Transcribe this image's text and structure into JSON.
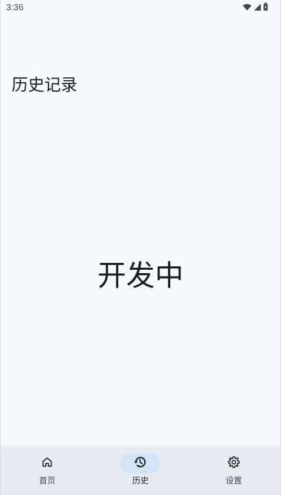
{
  "status_bar": {
    "time": "3:36",
    "icons": [
      "wifi-icon",
      "signal-icon",
      "battery-icon"
    ]
  },
  "page": {
    "title": "历史记录",
    "center_text": "开发中"
  },
  "bottom_nav": {
    "items": [
      {
        "label": "首页",
        "icon": "home-icon",
        "active": false
      },
      {
        "label": "历史",
        "icon": "history-icon",
        "active": true
      },
      {
        "label": "设置",
        "icon": "gear-icon",
        "active": false
      }
    ]
  },
  "colors": {
    "background": "#f6faff",
    "nav_background": "#e6ebf1",
    "active_indicator": "#d2e4f7",
    "text": "#1a1c1e"
  }
}
